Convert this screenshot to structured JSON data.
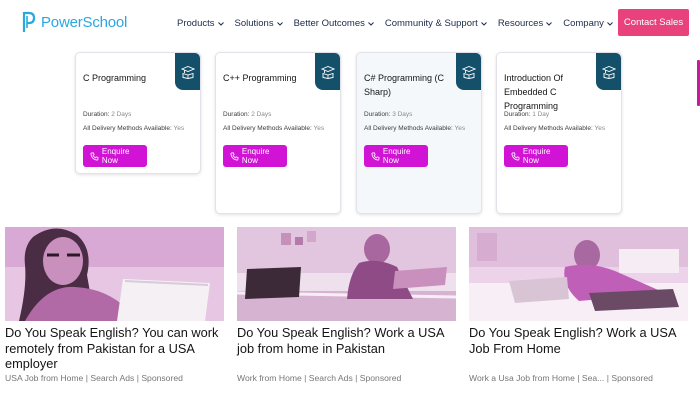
{
  "header": {
    "logo_text": "PowerSchool",
    "nav": [
      {
        "label": "Products"
      },
      {
        "label": "Solutions"
      },
      {
        "label": "Better Outcomes"
      },
      {
        "label": "Community & Support"
      },
      {
        "label": "Resources"
      },
      {
        "label": "Company"
      }
    ],
    "contact_label": "Contact Sales"
  },
  "cards": [
    {
      "title": "C Programming",
      "duration_label": "Duration:",
      "duration": "2 Days",
      "delivery_label": "All Delivery Methods Available:",
      "delivery": "Yes",
      "button": "Enquire Now"
    },
    {
      "title": "C++ Programming",
      "duration_label": "Duration:",
      "duration": "2 Days",
      "delivery_label": "All Delivery Methods Available:",
      "delivery": "Yes",
      "button": "Enquire Now"
    },
    {
      "title": "C# Programming (C Sharp)",
      "duration_label": "Duration:",
      "duration": "3 Days",
      "delivery_label": "All Delivery Methods Available:",
      "delivery": "Yes",
      "button": "Enquire Now"
    },
    {
      "title": "Introduction Of Embedded C Programming",
      "duration_label": "Duration:",
      "duration": "1 Day",
      "delivery_label": "All Delivery Methods Available:",
      "delivery": "Yes",
      "button": "Enquire Now"
    }
  ],
  "articles": [
    {
      "headline": "Do You Speak English? You can work remotely from Pakistan for a USA employer",
      "source": "USA Job from Home | Search Ads",
      "sponsored": "Sponsored"
    },
    {
      "headline": "Do You Speak English? Work a USA job from home in Pakistan",
      "source": "Work from Home | Search Ads",
      "sponsored": "Sponsored"
    },
    {
      "headline": "Do You Speak English? Work a USA Job From Home",
      "source": "Work a Usa Job from Home | Sea...",
      "sponsored": "Sponsored"
    }
  ],
  "colors": {
    "brand_blue": "#29a8e0",
    "contact_pink": "#e8417c",
    "enquire_magenta": "#d113d6",
    "card_corner": "#15506a"
  },
  "icons": {
    "logo": "powerschool-logo-icon",
    "nav_chevron": "chevron-down-icon",
    "card_corner": "graduation-book-icon",
    "enquire": "phone-icon"
  }
}
